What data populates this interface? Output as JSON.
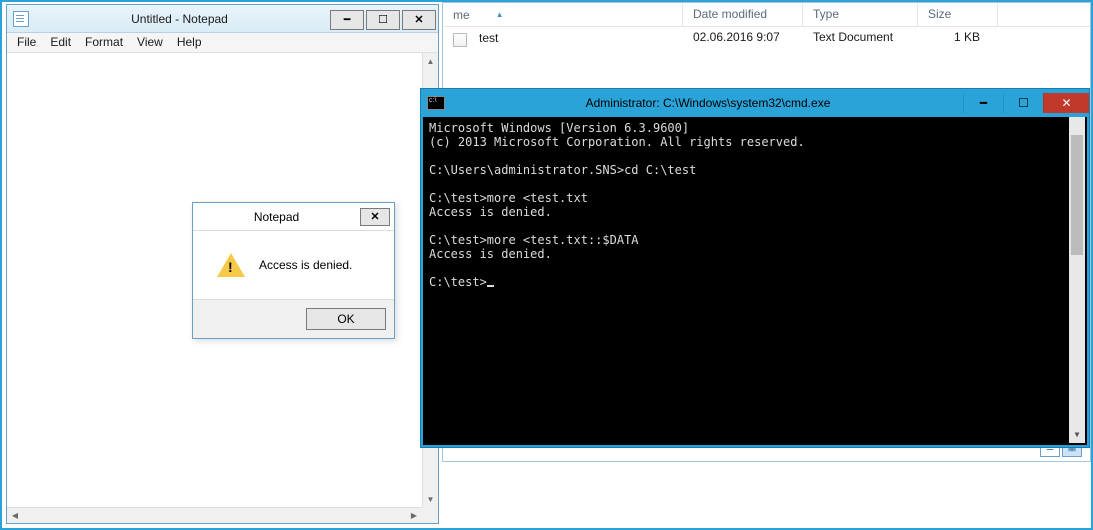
{
  "explorer": {
    "columns": {
      "name": "me",
      "date": "Date modified",
      "type": "Type",
      "size": "Size"
    },
    "row": {
      "name": "test",
      "date": "02.06.2016 9:07",
      "type": "Text Document",
      "size": "1 KB"
    }
  },
  "notepad": {
    "title": "Untitled - Notepad",
    "menu": {
      "file": "File",
      "edit": "Edit",
      "format": "Format",
      "view": "View",
      "help": "Help"
    }
  },
  "msgbox": {
    "title": "Notepad",
    "text": "Access is denied.",
    "ok": "OK"
  },
  "cmd": {
    "title": "Administrator: C:\\Windows\\system32\\cmd.exe",
    "lines": [
      "Microsoft Windows [Version 6.3.9600]",
      "(c) 2013 Microsoft Corporation. All rights reserved.",
      "",
      "C:\\Users\\administrator.SNS>cd C:\\test",
      "",
      "C:\\test>more <test.txt",
      "Access is denied.",
      "",
      "C:\\test>more <test.txt::$DATA",
      "Access is denied.",
      "",
      "C:\\test>"
    ]
  }
}
